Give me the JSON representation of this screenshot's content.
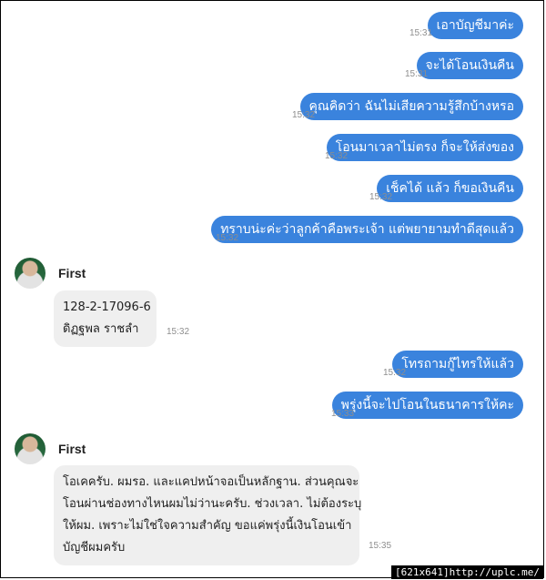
{
  "outgoing": [
    {
      "text": "เอาบัญชีมาค่ะ",
      "time": "15:31"
    },
    {
      "text": "จะได้โอนเงินคืน",
      "time": "15:31"
    },
    {
      "text": "คุณคิดว่า ฉันไม่เสียความรู้สึกบ้างหรอ",
      "time": "15:32"
    },
    {
      "text": "โอนมาเวลาไม่ตรง ก็จะให้ส่งของ",
      "time": "15:32"
    },
    {
      "text": "เช็คได้ แล้ว ก็ขอเงินคืน",
      "time": "15:32"
    },
    {
      "text": "ทราบน่ะค่ะว่าลูกค้าคือพระเจ้า แต่พยายามทำดีสุดแล้ว",
      "time": "15:32"
    },
    {
      "text": "โทรถามกู๊ไทรให้แล้ว",
      "time": "15:32"
    },
    {
      "text": "พรุ่งนี้จะไปโอนในธนาคารให้คะ",
      "time": "15:33"
    }
  ],
  "incoming": [
    {
      "sender": "First",
      "lines": [
        "128-2-17096-6",
        "ดิฏฐพล ราชลำ"
      ],
      "time": "15:32"
    },
    {
      "sender": "First",
      "lines": [
        "โอเคครับ. ผมรอ. และแคปหน้าจอเป็นหลักฐาน. ส่วนคุณจะ",
        "โอนผ่านช่องทางไหนผมไม่ว่านะครับ. ช่วงเวลา. ไม่ต้องระบุ",
        "ให้ผม. เพราะไม่ใช่ใจความสำคัญ ขอแค่พรุ่งนี้เงินโอนเข้า",
        "บัญชีผมครับ"
      ],
      "time": "15:35"
    }
  ],
  "watermark": "[621x641]http://uplc.me/"
}
